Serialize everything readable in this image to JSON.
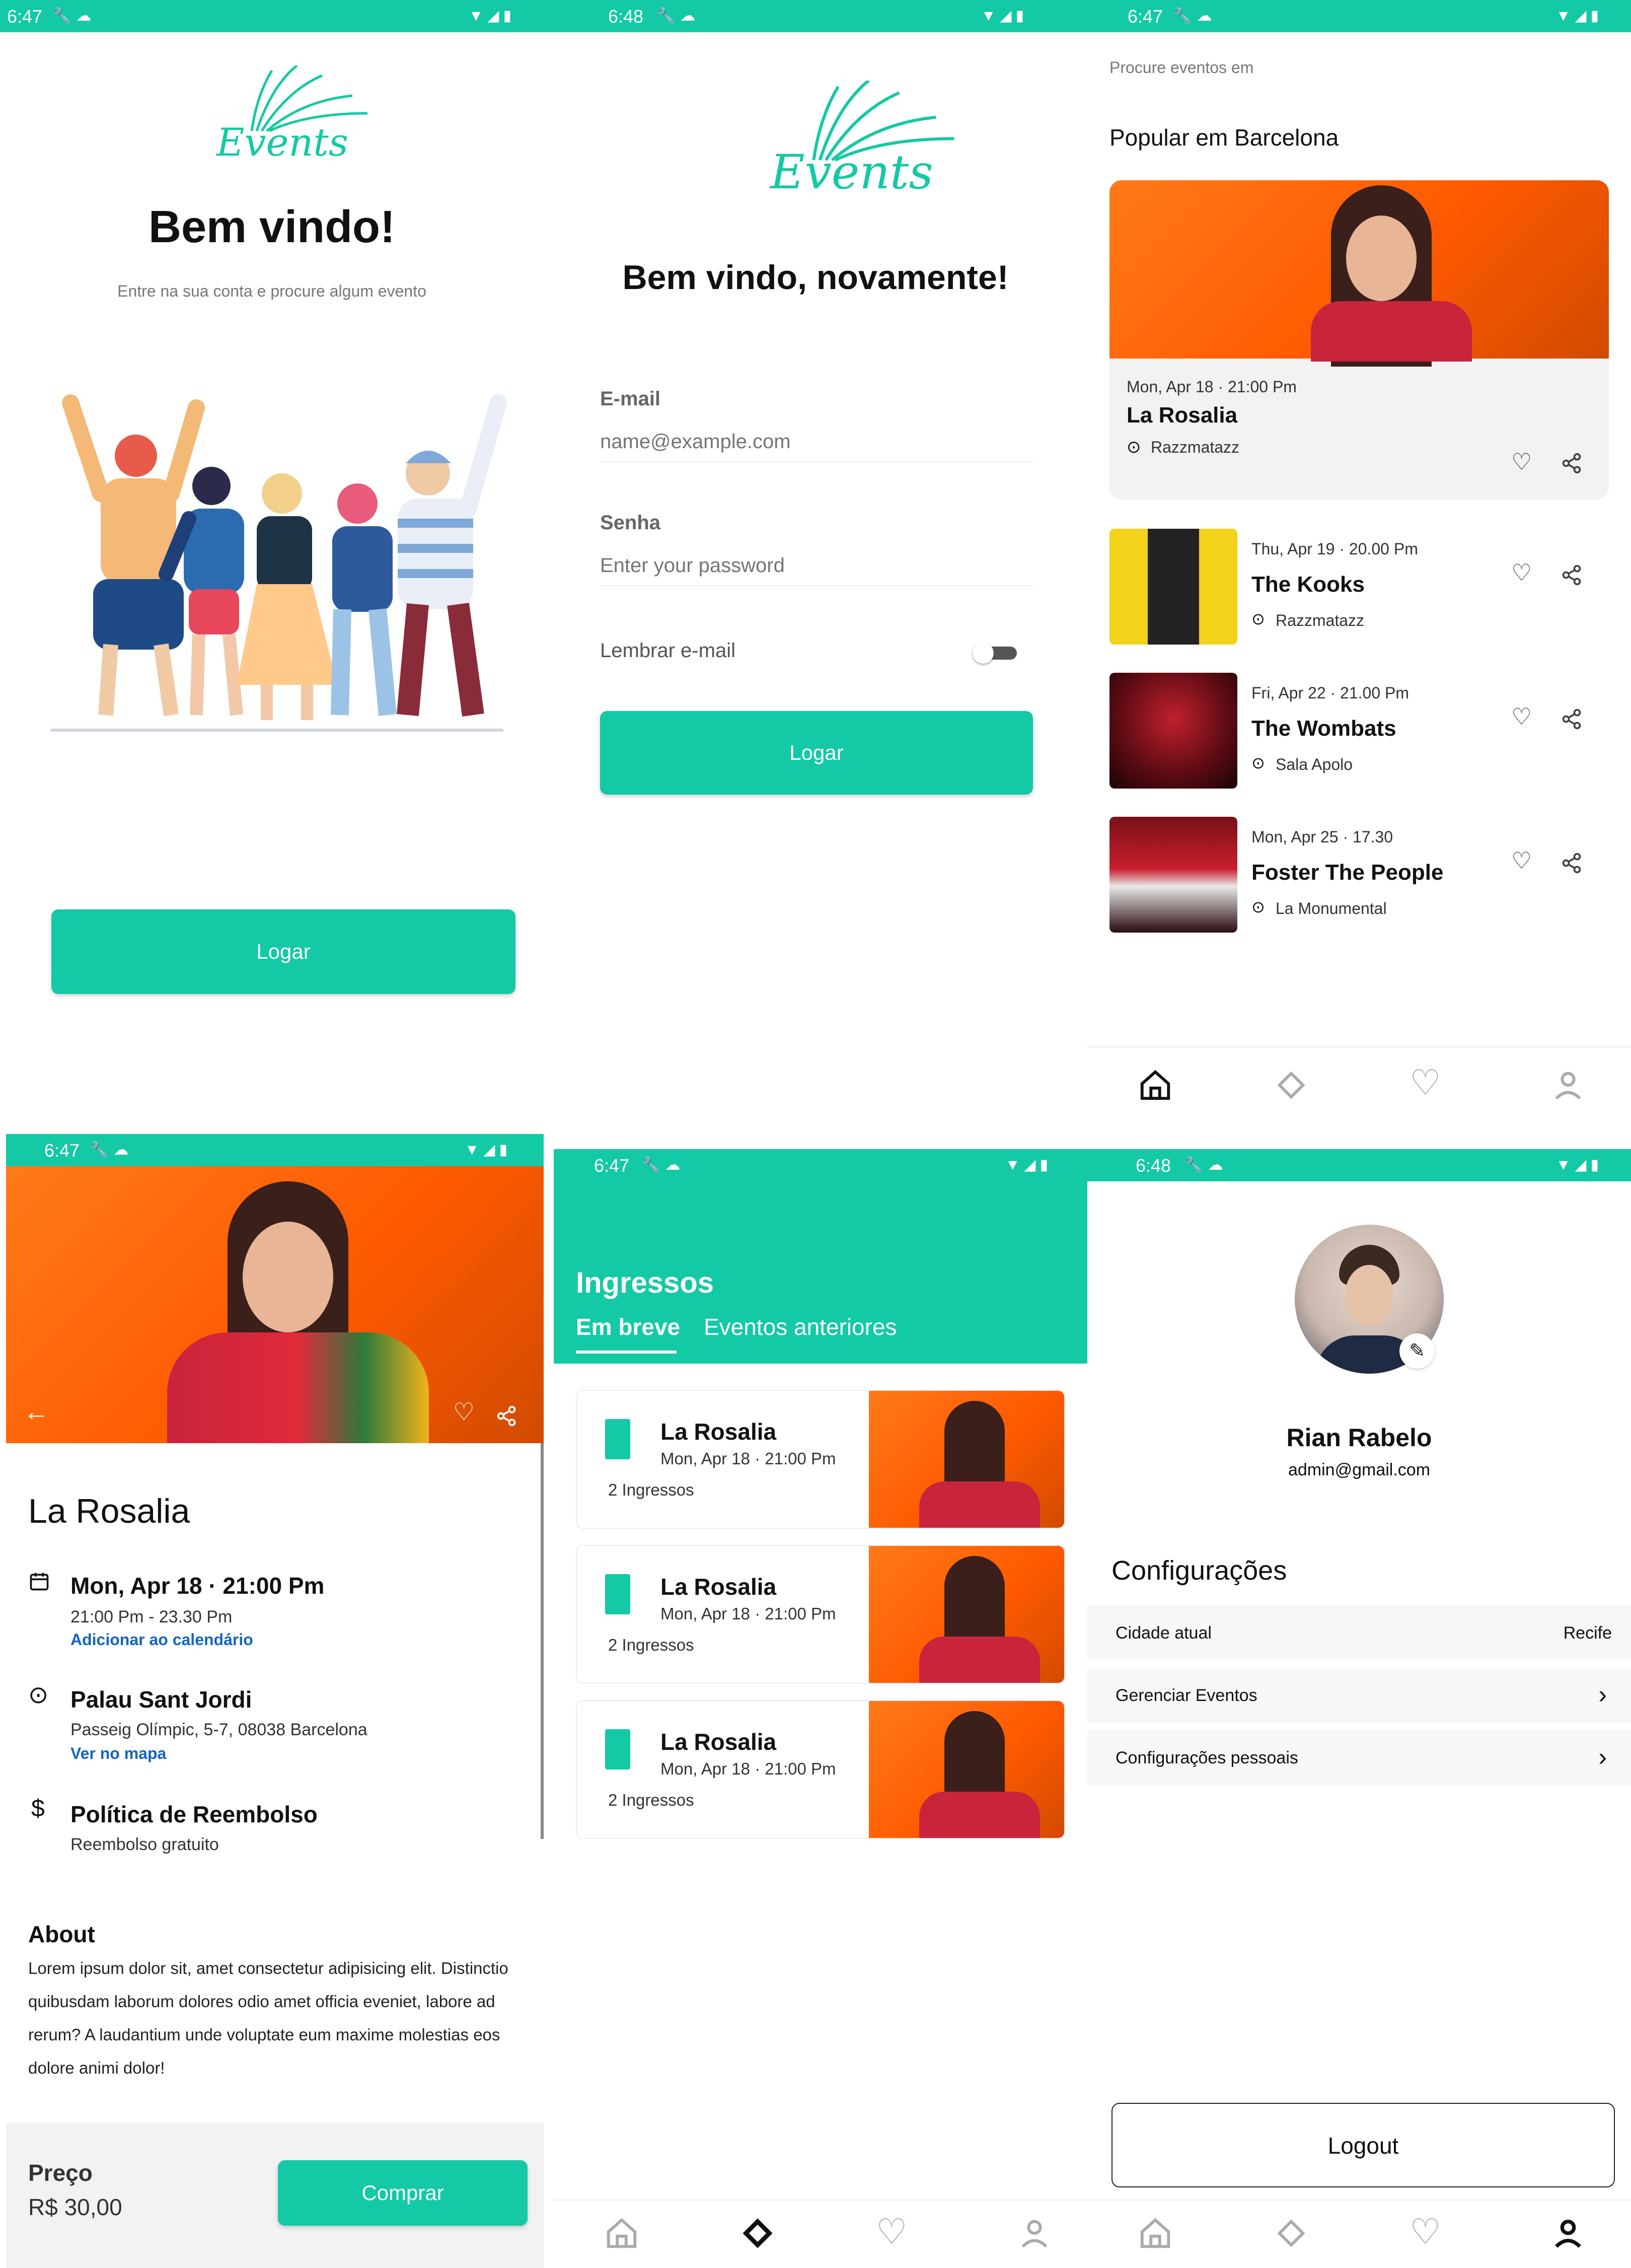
{
  "colors": {
    "accent": "#14c9a5",
    "link": "#1565c0",
    "text": "#111111",
    "muted": "#777777"
  },
  "status": {
    "s1": "6:47",
    "s2": "6:48",
    "s3": "6:47",
    "s4": "6:47",
    "s5": "6:47",
    "s6": "6:48"
  },
  "welcome": {
    "logo": "Events",
    "title": "Bem vindo!",
    "subtitle": "Entre na sua conta e procure algum evento",
    "login_button": "Logar"
  },
  "login": {
    "logo": "Events",
    "title": "Bem vindo, novamente!",
    "email_label": "E-mail",
    "email_placeholder": "name@example.com",
    "password_label": "Senha",
    "password_placeholder": "Enter your password",
    "remember_label": "Lembrar e-mail",
    "login_button": "Logar"
  },
  "home": {
    "search_label": "Procure eventos em",
    "section_title": "Popular em Barcelona",
    "featured": {
      "date": "Mon, Apr 18 · 21:00 Pm",
      "title": "La Rosalia",
      "venue": "Razzmatazz"
    },
    "events": [
      {
        "date": "Thu, Apr 19 · 20.00 Pm",
        "title": "The Kooks",
        "venue": "Razzmatazz"
      },
      {
        "date": "Fri, Apr 22 · 21.00 Pm",
        "title": "The Wombats",
        "venue": "Sala Apolo"
      },
      {
        "date": "Mon, Apr 25  · 17.30",
        "title": "Foster The People",
        "venue": "La Monumental"
      }
    ]
  },
  "detail": {
    "title": "La Rosalia",
    "date": "Mon, Apr 18 · 21:00 Pm",
    "time_range": "21:00 Pm - 23.30 Pm",
    "calendar_link": "Adicionar ao calendário",
    "venue": "Palau Sant Jordi",
    "address": "Passeig Olímpic, 5-7, 08038 Barcelona",
    "map_link": "Ver no mapa",
    "refund_title": "Política de Reembolso",
    "refund_text": "Reembolso gratuito",
    "about_title": "About",
    "about_text": "Lorem ipsum dolor sit, amet consectetur adipisicing elit. Distinctio quibusdam laborum dolores odio amet officia eveniet, labore ad rerum? A laudantium unde voluptate eum maxime molestias eos dolore animi dolor!",
    "price_label": "Preço",
    "price": "R$ 30,00",
    "buy_button": "Comprar"
  },
  "tickets": {
    "title": "Ingressos",
    "tab_upcoming": "Em breve",
    "tab_past": "Eventos anteriores",
    "items": [
      {
        "title": "La Rosalia",
        "date": "Mon, Apr 18 · 21:00 Pm",
        "count": "2 Ingressos"
      },
      {
        "title": "La Rosalia",
        "date": "Mon, Apr 18 · 21:00 Pm",
        "count": "2 Ingressos"
      },
      {
        "title": "La Rosalia",
        "date": "Mon, Apr 18 · 21:00 Pm",
        "count": "2 Ingressos"
      }
    ]
  },
  "profile": {
    "name": "Rian Rabelo",
    "email": "admin@gmail.com",
    "settings_title": "Configurações",
    "city_label": "Cidade atual",
    "city_value": "Recife",
    "manage_events": "Gerenciar Eventos",
    "personal_settings": "Configurações pessoais",
    "logout_button": "Logout"
  },
  "icons": [
    "home-icon",
    "ticket-icon",
    "heart-icon",
    "user-icon",
    "share-icon",
    "location-icon",
    "calendar-icon",
    "dollar-icon",
    "back-arrow-icon",
    "chevron-right-icon",
    "edit-icon",
    "wifi-icon",
    "signal-icon",
    "battery-icon",
    "wrench-icon",
    "cloud-icon"
  ]
}
